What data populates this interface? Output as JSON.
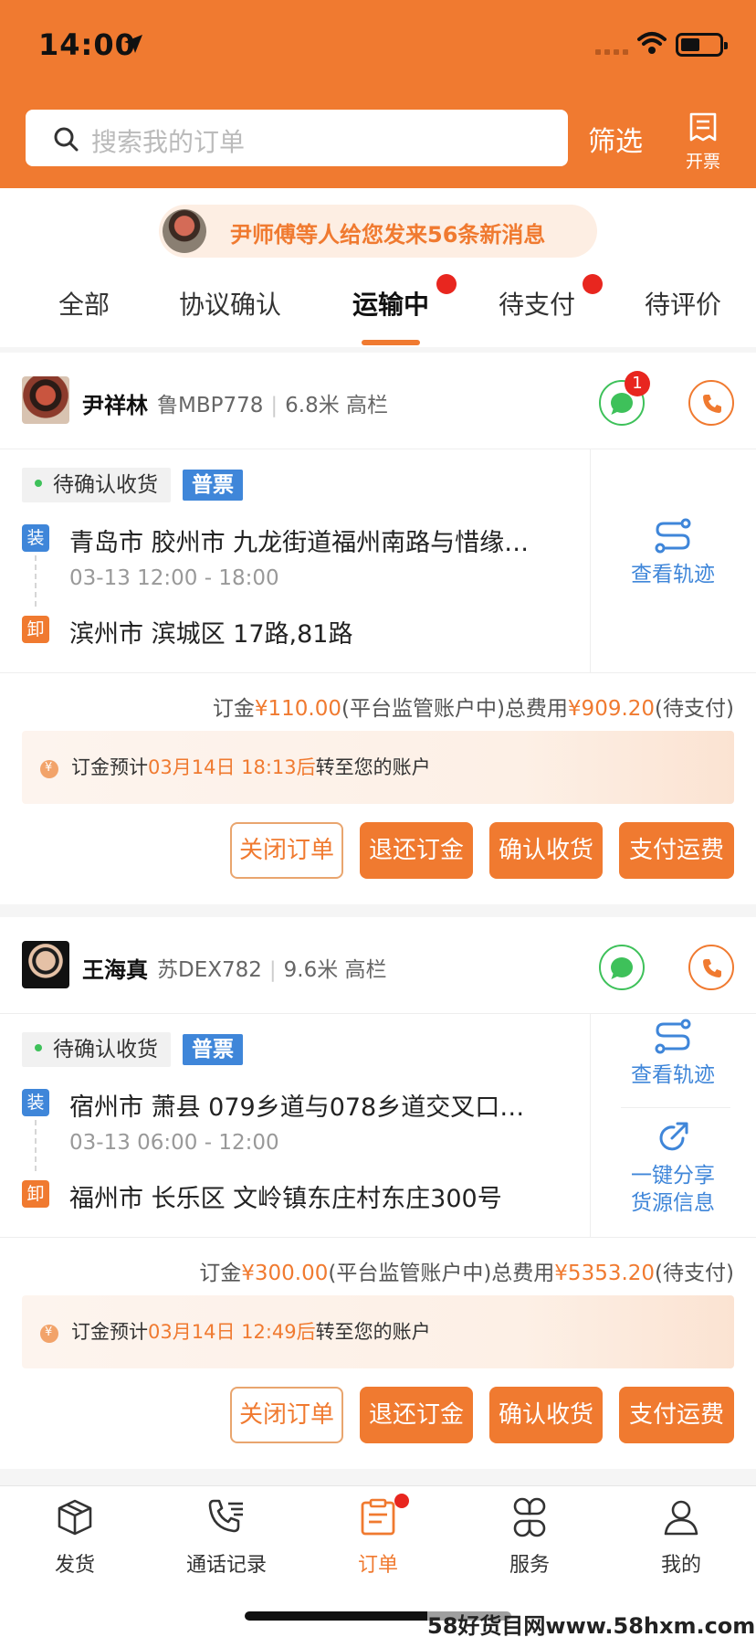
{
  "status_bar": {
    "time": "14:00"
  },
  "header": {
    "search_placeholder": "搜索我的订单",
    "filter_label": "筛选",
    "invoice_label": "开票"
  },
  "notification": {
    "text": "尹师傅等人给您发来56条新消息"
  },
  "tabs": [
    {
      "label": "全部",
      "active": false,
      "dot": false
    },
    {
      "label": "协议确认",
      "active": false,
      "dot": false
    },
    {
      "label": "运输中",
      "active": true,
      "dot": true
    },
    {
      "label": "待支付",
      "active": false,
      "dot": true
    },
    {
      "label": "待评价",
      "active": false,
      "dot": false
    }
  ],
  "orders": [
    {
      "driver_name": "尹祥林",
      "plate": "鲁MBP778",
      "truck": "6.8米 高栏",
      "chat_badge": "1",
      "status": "待确认收货",
      "invoice_type": "普票",
      "load_tag": "装",
      "unload_tag": "卸",
      "load_address": "青岛市 胶州市 九龙街道福州南路与惜缘…",
      "load_time": "03-13 12:00 - 18:00",
      "unload_address": "滨州市 滨城区 17路,81路",
      "side_actions": [
        "查看轨迹"
      ],
      "fee": {
        "deposit_label": "订金",
        "deposit": "¥110.00",
        "deposit_note": "(平台监管账户中)总费用",
        "total": "¥909.20",
        "total_note": "(待支付)"
      },
      "notice": {
        "prefix": "订金预计",
        "time": "03月14日 18:13后",
        "suffix": "转至您的账户"
      },
      "buttons": [
        "关闭订单",
        "退还订金",
        "确认收货",
        "支付运费"
      ]
    },
    {
      "driver_name": "王海真",
      "plate": "苏DEX782",
      "truck": "9.6米 高栏",
      "chat_badge": "",
      "status": "待确认收货",
      "invoice_type": "普票",
      "load_tag": "装",
      "unload_tag": "卸",
      "load_address": "宿州市 萧县 079乡道与078乡道交叉口…",
      "load_time": "03-13 06:00 - 12:00",
      "unload_address": "福州市 长乐区 文岭镇东庄村东庄300号",
      "side_actions": [
        "查看轨迹",
        "一键分享",
        "货源信息"
      ],
      "fee": {
        "deposit_label": "订金",
        "deposit": "¥300.00",
        "deposit_note": "(平台监管账户中)总费用",
        "total": "¥5353.20",
        "total_note": "(待支付)"
      },
      "notice": {
        "prefix": "订金预计",
        "time": "03月14日 12:49后",
        "suffix": "转至您的账户"
      },
      "buttons": [
        "关闭订单",
        "退还订金",
        "确认收货",
        "支付运费"
      ]
    }
  ],
  "tabbar": [
    {
      "label": "发货",
      "icon": "box-icon",
      "active": false
    },
    {
      "label": "通话记录",
      "icon": "call-log-icon",
      "active": false
    },
    {
      "label": "订单",
      "icon": "order-icon",
      "active": true
    },
    {
      "label": "服务",
      "icon": "services-icon",
      "active": false
    },
    {
      "label": "我的",
      "icon": "profile-icon",
      "active": false
    }
  ],
  "watermark": "58好货目网www.58hxm.com",
  "colors": {
    "brand": "#f07a30",
    "blue": "#3f86d9",
    "green": "#3ec15a",
    "red": "#e8261f"
  }
}
